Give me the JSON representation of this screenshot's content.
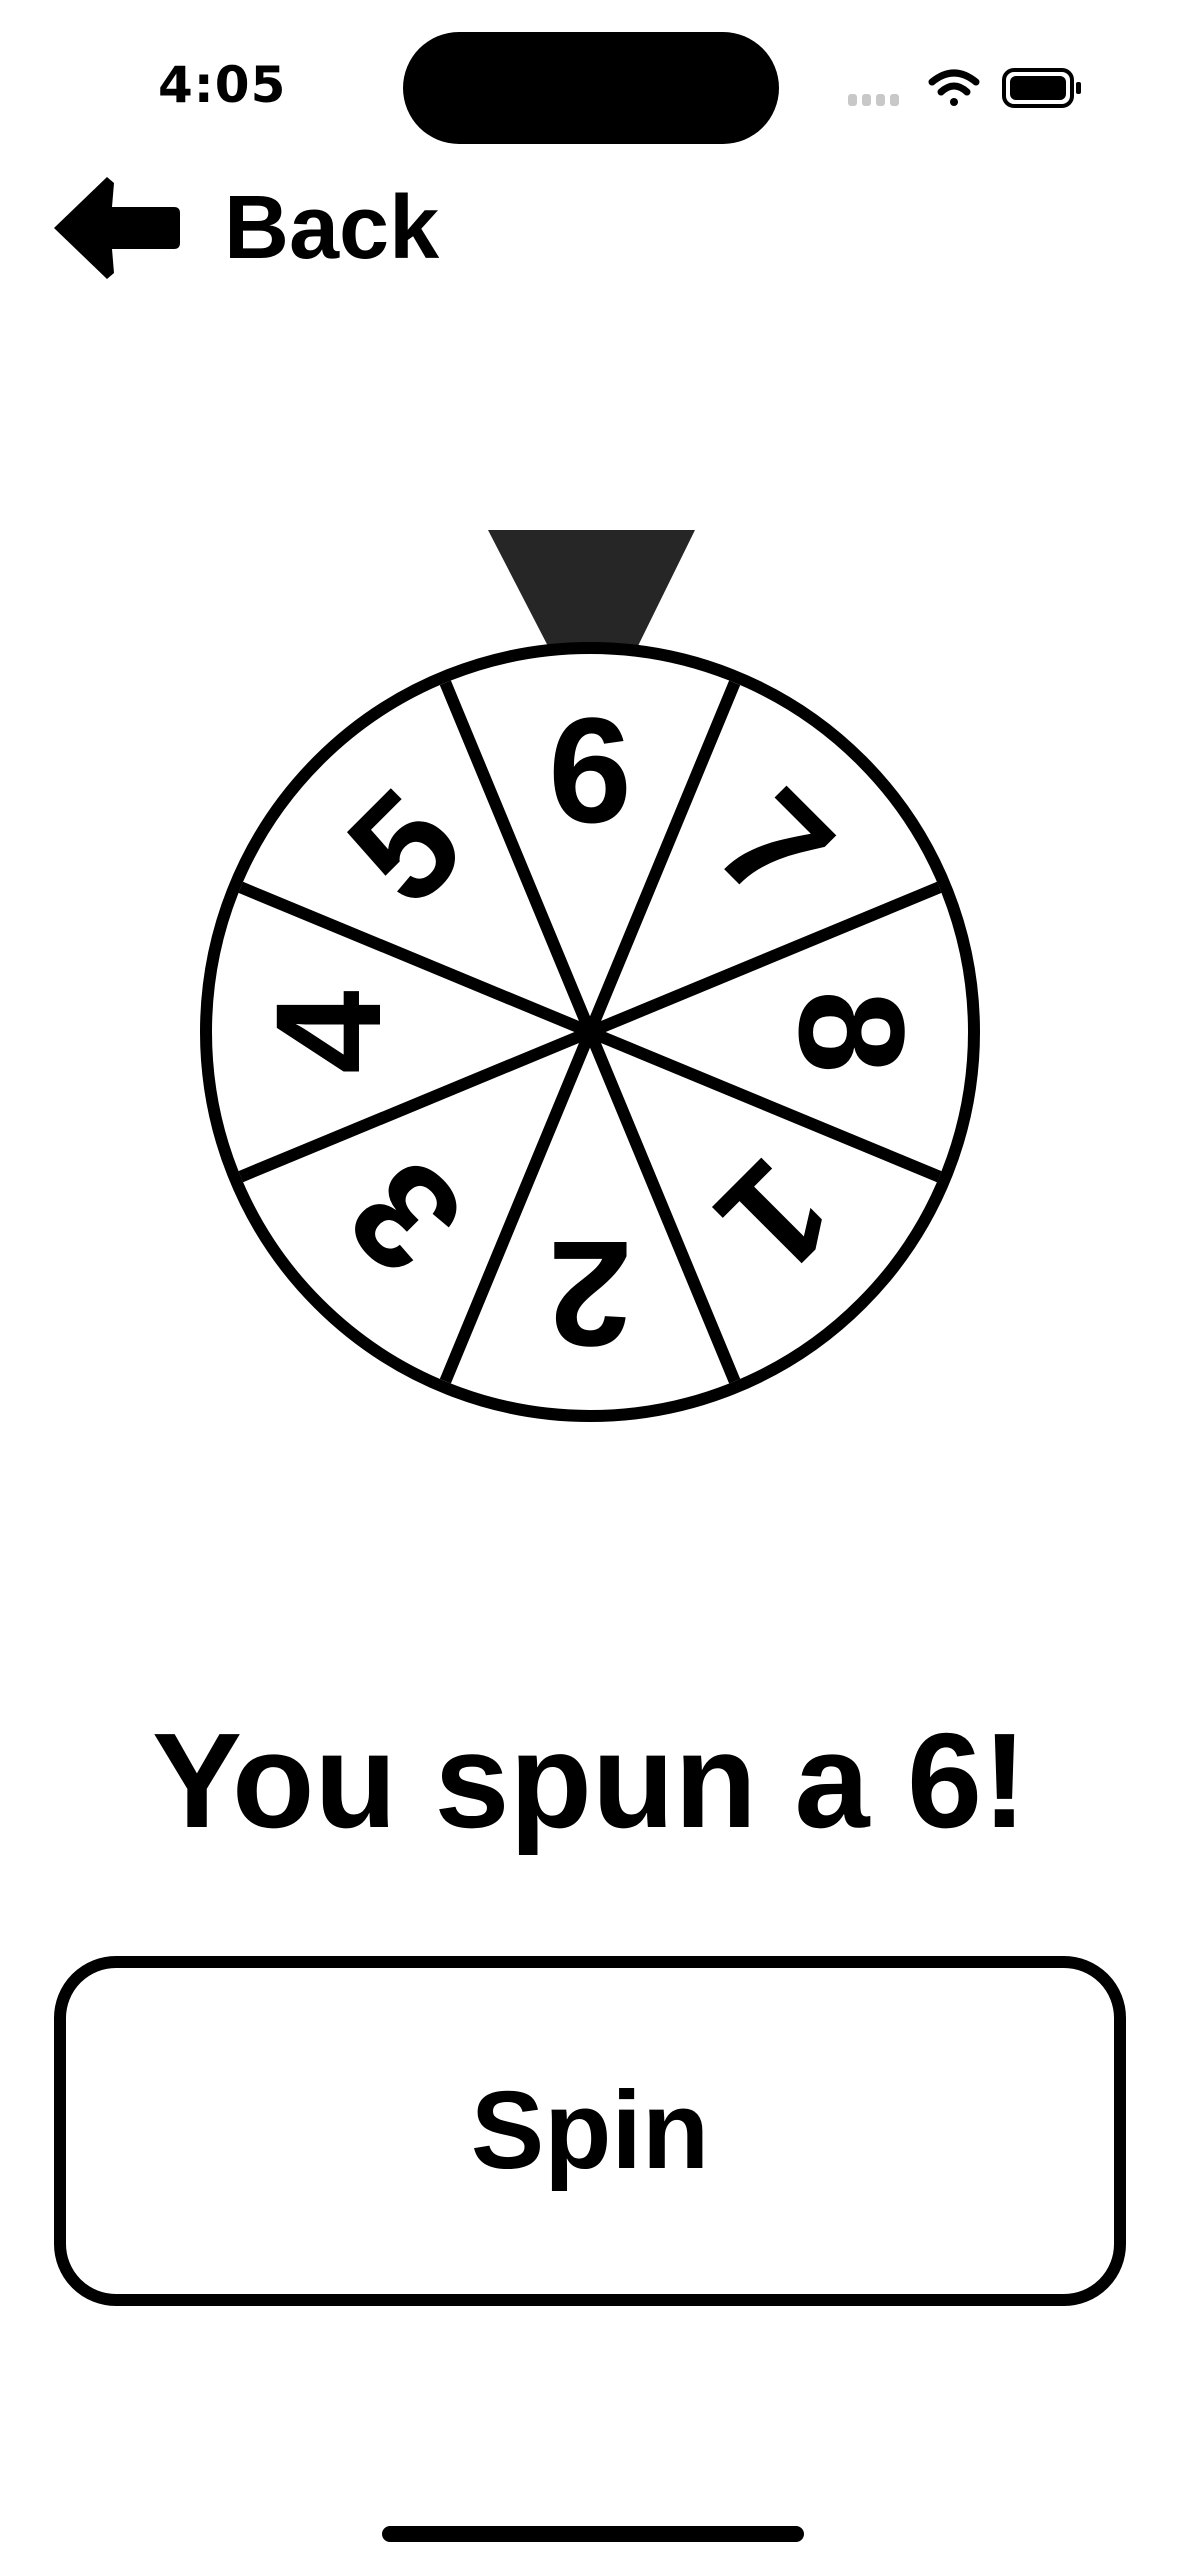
{
  "status_bar": {
    "time": "4:05",
    "icons": [
      "cellular-signal-icon",
      "wifi-icon",
      "battery-icon"
    ]
  },
  "nav": {
    "back_label": "Back",
    "back_icon": "arrow-left-icon"
  },
  "wheel": {
    "segments": [
      "6",
      "7",
      "8",
      "1",
      "2",
      "3",
      "4",
      "5"
    ],
    "pointer_color": "#262626"
  },
  "result": {
    "text": "You spun a 6!"
  },
  "spin_button": {
    "label": "Spin"
  }
}
